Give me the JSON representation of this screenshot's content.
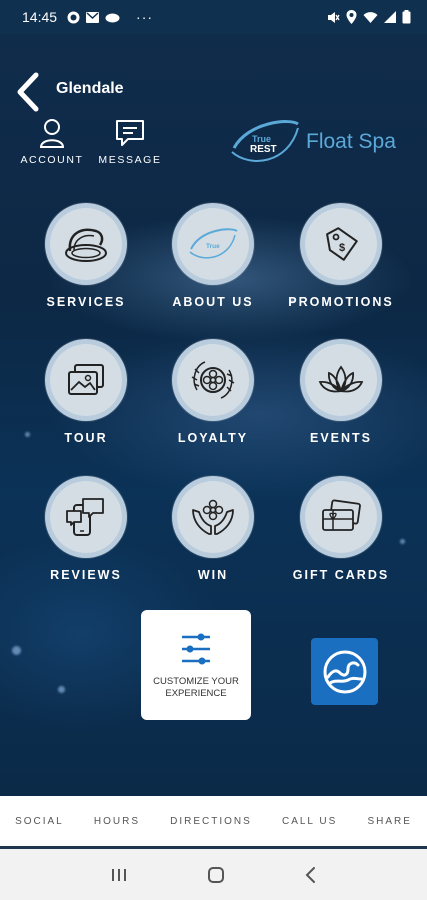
{
  "status_bar": {
    "time": "14:45",
    "left_icons": [
      "vpn-icon",
      "gmail-icon",
      "cloud-icon"
    ],
    "more": "···",
    "right_icons": [
      "mute-icon",
      "location-icon",
      "wifi-icon",
      "signal-icon",
      "battery-icon"
    ]
  },
  "header": {
    "location": "Glendale",
    "account_label": "ACCOUNT",
    "message_label": "MESSAGE",
    "brand_badge_top": "True",
    "brand_badge_bottom": "REST",
    "brand_name": "Float Spa"
  },
  "tiles": [
    {
      "label": "SERVICES",
      "icon": "float-pod-icon"
    },
    {
      "label": "ABOUT US",
      "icon": "true-rest-logo-icon"
    },
    {
      "label": "PROMOTIONS",
      "icon": "price-tag-icon"
    },
    {
      "label": "TOUR",
      "icon": "photo-gallery-icon"
    },
    {
      "label": "LOYALTY",
      "icon": "flower-badge-icon"
    },
    {
      "label": "EVENTS",
      "icon": "lotus-icon"
    },
    {
      "label": "REVIEWS",
      "icon": "phone-chat-icon"
    },
    {
      "label": "WIN",
      "icon": "hands-flower-icon"
    },
    {
      "label": "GIFT CARDS",
      "icon": "gift-card-icon"
    }
  ],
  "customize": {
    "label": "CUSTOMIZE YOUR EXPERIENCE",
    "icon": "sliders-icon"
  },
  "wave_button": {
    "icon": "wave-icon",
    "color": "#1a6fc1"
  },
  "bottom_nav": [
    "SOCIAL",
    "HOURS",
    "DIRECTIONS",
    "CALL US",
    "SHARE"
  ],
  "system_nav": [
    "recent-apps-icon",
    "home-icon",
    "back-icon"
  ],
  "colors": {
    "accent": "#5ba9d8",
    "wave_blue": "#1a6fc1",
    "background": "#0b2540",
    "tile_fill": "#d4dde4"
  }
}
